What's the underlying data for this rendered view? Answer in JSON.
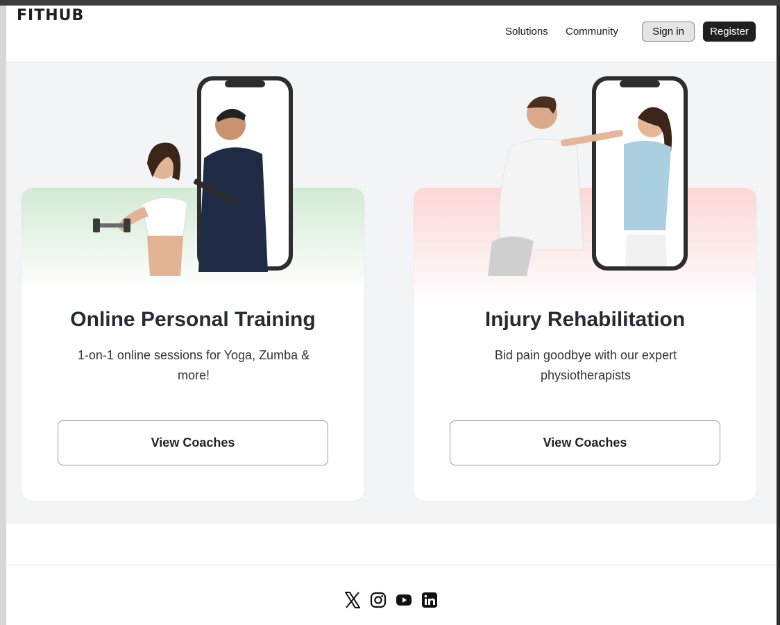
{
  "header": {
    "logo": "FITHUB",
    "nav": {
      "solutions": "Solutions",
      "community": "Community"
    },
    "sign_in": "Sign in",
    "register": "Register"
  },
  "cards": [
    {
      "title": "Online Personal Training",
      "description": "1-on-1 online sessions for Yoga, Zumba & more!",
      "button": "View Coaches",
      "accent": "#d2ead3"
    },
    {
      "title": "Injury Rehabilitation",
      "description": "Bid pain goodbye with our expert physiotherapists",
      "button": "View Coaches",
      "accent": "#fcd7d6"
    }
  ],
  "footer": {
    "socials": [
      "x-icon",
      "instagram-icon",
      "youtube-icon",
      "linkedin-icon"
    ]
  }
}
